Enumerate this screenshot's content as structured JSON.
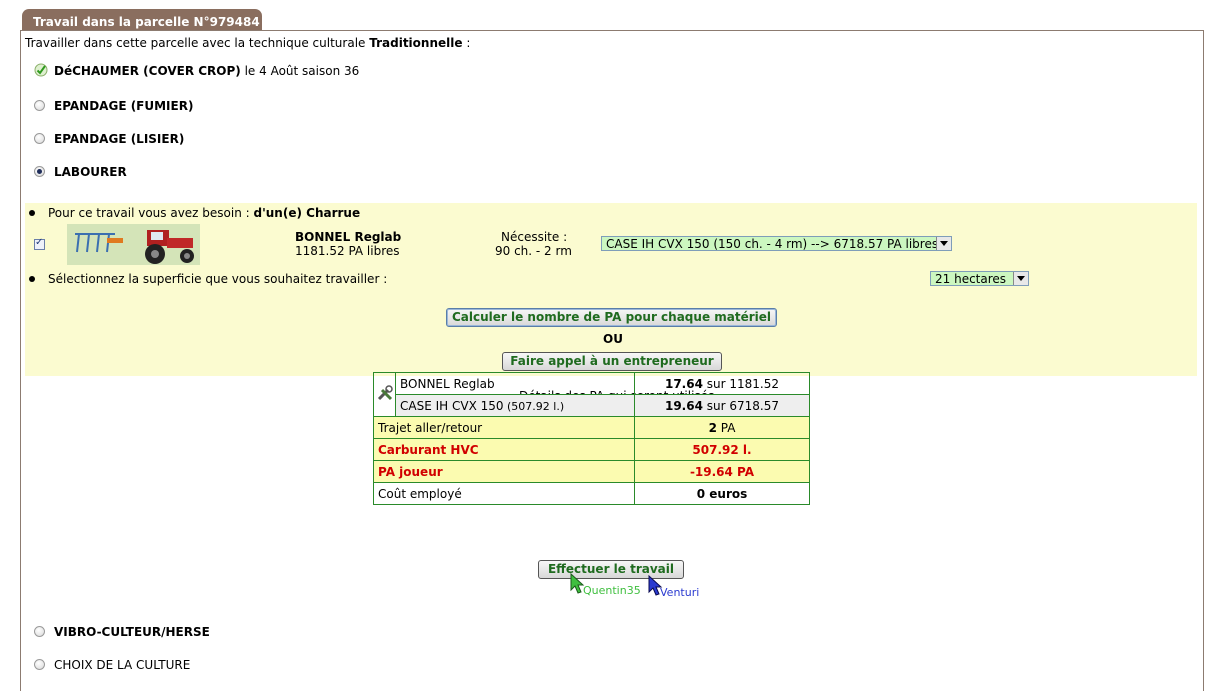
{
  "tab": {
    "title": "Travail dans la parcelle N°979484"
  },
  "intro": {
    "prefix": "Travailler dans cette parcelle avec la technique culturale ",
    "technique": "Traditionnelle",
    "suffix": " :"
  },
  "options": {
    "dechaumer": {
      "label": "DéCHAUMER (COVER CROP)",
      "detail": " le 4 Août saison 36"
    },
    "epandage_fumier": {
      "label": "EPANDAGE (FUMIER)"
    },
    "epandage_lisier": {
      "label": "EPANDAGE (LISIER)"
    },
    "labourer": {
      "label": "LABOURER"
    },
    "vibro": {
      "label": "VIBRO-CULTEUR/HERSE"
    },
    "choix_culture": {
      "label": "CHOIX DE LA CULTURE"
    }
  },
  "besoin": {
    "prefix": "Pour ce travail vous avez besoin : ",
    "item": "d'un(e) Charrue"
  },
  "machine": {
    "name": "BONNEL Reglab",
    "pa": "1181.52 PA libres",
    "necessite_label": "Nécessite :",
    "necessite_value": "90 ch. - 2 rm"
  },
  "tractor_select": {
    "value": "CASE IH CVX 150 (150 ch. - 4 rm) --> 6718.57 PA libres"
  },
  "superficie": {
    "label": "Sélectionnez la superficie que vous souhaitez travailler :",
    "value": "21 hectares"
  },
  "buttons": {
    "calculer": "Calculer le nombre de PA pour chaque matériel",
    "ou": "OU",
    "entrepreneur": "Faire appel à un entrepreneur",
    "effectuer": "Effectuer le travail"
  },
  "details": {
    "title": "Détails des PA qui seront utilisés",
    "rows": [
      {
        "label": "BONNEL Reglab",
        "value": "17.64",
        "suffix": " sur 1181.52"
      },
      {
        "label": "CASE IH CVX 150",
        "label_small": " (507.92 l.)",
        "value": "19.64",
        "suffix": " sur 6718.57"
      },
      {
        "label": "Trajet aller/retour",
        "value": "2",
        "suffix": " PA"
      },
      {
        "label": "Carburant HVC",
        "value": "507.92 l."
      },
      {
        "label": "PA joueur",
        "value": "-19.64 PA"
      },
      {
        "label": "Coût employé",
        "value": "0 euros"
      }
    ]
  },
  "cursors": {
    "user1": "Quentin35",
    "user2": "Venturi"
  },
  "colors": {
    "tab": "#8a6e5f",
    "yellow_panel": "#fbfbd0",
    "button_text": "#1f6b1f",
    "red": "#d10000",
    "table_border": "#2a8a2a"
  }
}
